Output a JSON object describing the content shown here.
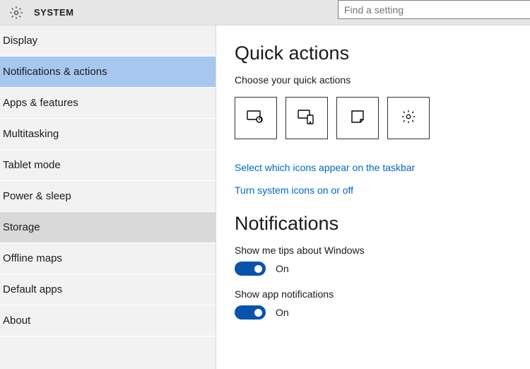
{
  "titlebar": {
    "title": "SYSTEM"
  },
  "search": {
    "placeholder": "Find a setting"
  },
  "sidebar": {
    "items": [
      {
        "label": "Display",
        "state": ""
      },
      {
        "label": "Notifications & actions",
        "state": "selected"
      },
      {
        "label": "Apps & features",
        "state": ""
      },
      {
        "label": "Multitasking",
        "state": ""
      },
      {
        "label": "Tablet mode",
        "state": ""
      },
      {
        "label": "Power & sleep",
        "state": ""
      },
      {
        "label": "Storage",
        "state": "hovered"
      },
      {
        "label": "Offline maps",
        "state": ""
      },
      {
        "label": "Default apps",
        "state": ""
      },
      {
        "label": "About",
        "state": ""
      }
    ]
  },
  "main": {
    "quick_actions": {
      "heading": "Quick actions",
      "sub": "Choose your quick actions",
      "tiles": [
        {
          "icon": "tablet-tap-icon"
        },
        {
          "icon": "connect-icon"
        },
        {
          "icon": "note-icon"
        },
        {
          "icon": "settings-gear-icon"
        }
      ],
      "link_taskbar": "Select which icons appear on the taskbar",
      "link_system_icons": "Turn system icons on or off"
    },
    "notifications": {
      "heading": "Notifications",
      "tips": {
        "label": "Show me tips about Windows",
        "state": "On"
      },
      "app_notifications": {
        "label": "Show app notifications",
        "state": "On"
      }
    }
  }
}
